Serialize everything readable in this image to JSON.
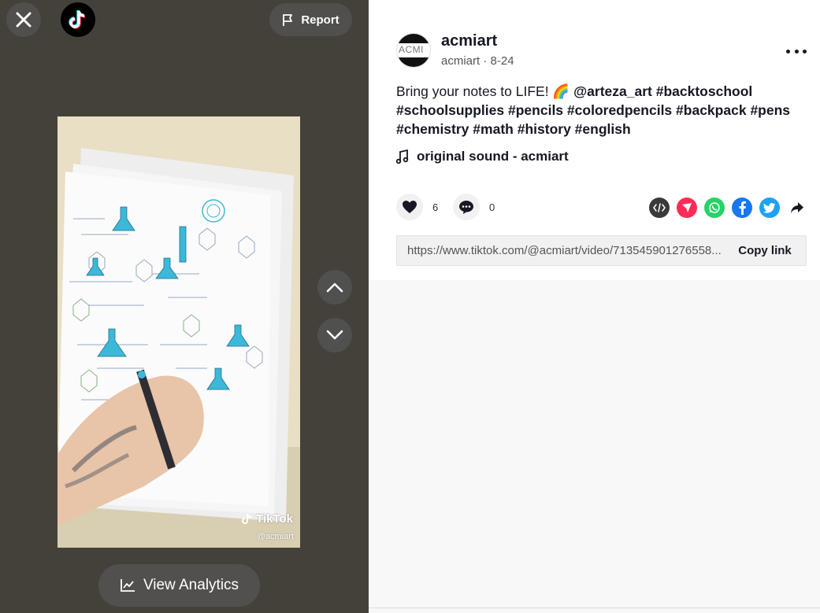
{
  "left_panel": {
    "report_label": "Report",
    "watermark": {
      "brand": "TikTok",
      "user": "@acmiart"
    },
    "analytics_label": "View Analytics"
  },
  "post": {
    "author_name": "acmiart",
    "author_handle": "acmiart",
    "date_separator": "·",
    "date": "8-24",
    "avatar_text": "ACMI",
    "caption": {
      "text": "Bring your notes to LIFE! 🌈 ",
      "mention": "@arteza_art",
      "tags": [
        "#backtoschool",
        "#schoolsupplies",
        "#pencils",
        "#coloredpencils",
        "#backpack",
        "#pens",
        "#chemistry",
        "#math",
        "#history",
        "#english"
      ]
    },
    "sound": "original sound - acmiart"
  },
  "actions": {
    "likes": "6",
    "comments": "0"
  },
  "share": {
    "icons": [
      "embed-icon",
      "send-to-friends-icon",
      "whatsapp-icon",
      "facebook-icon",
      "twitter-icon",
      "share-arrow-icon"
    ]
  },
  "link": {
    "url": "https://www.tiktok.com/@acmiart/video/713545901276558...",
    "copy_label": "Copy link"
  },
  "colors": {
    "left_bg": "#44413a",
    "embed": "#3a3a3a",
    "send": "#fe2c55",
    "whatsapp": "#25d366",
    "facebook": "#1877f2",
    "twitter": "#1da1f2"
  }
}
